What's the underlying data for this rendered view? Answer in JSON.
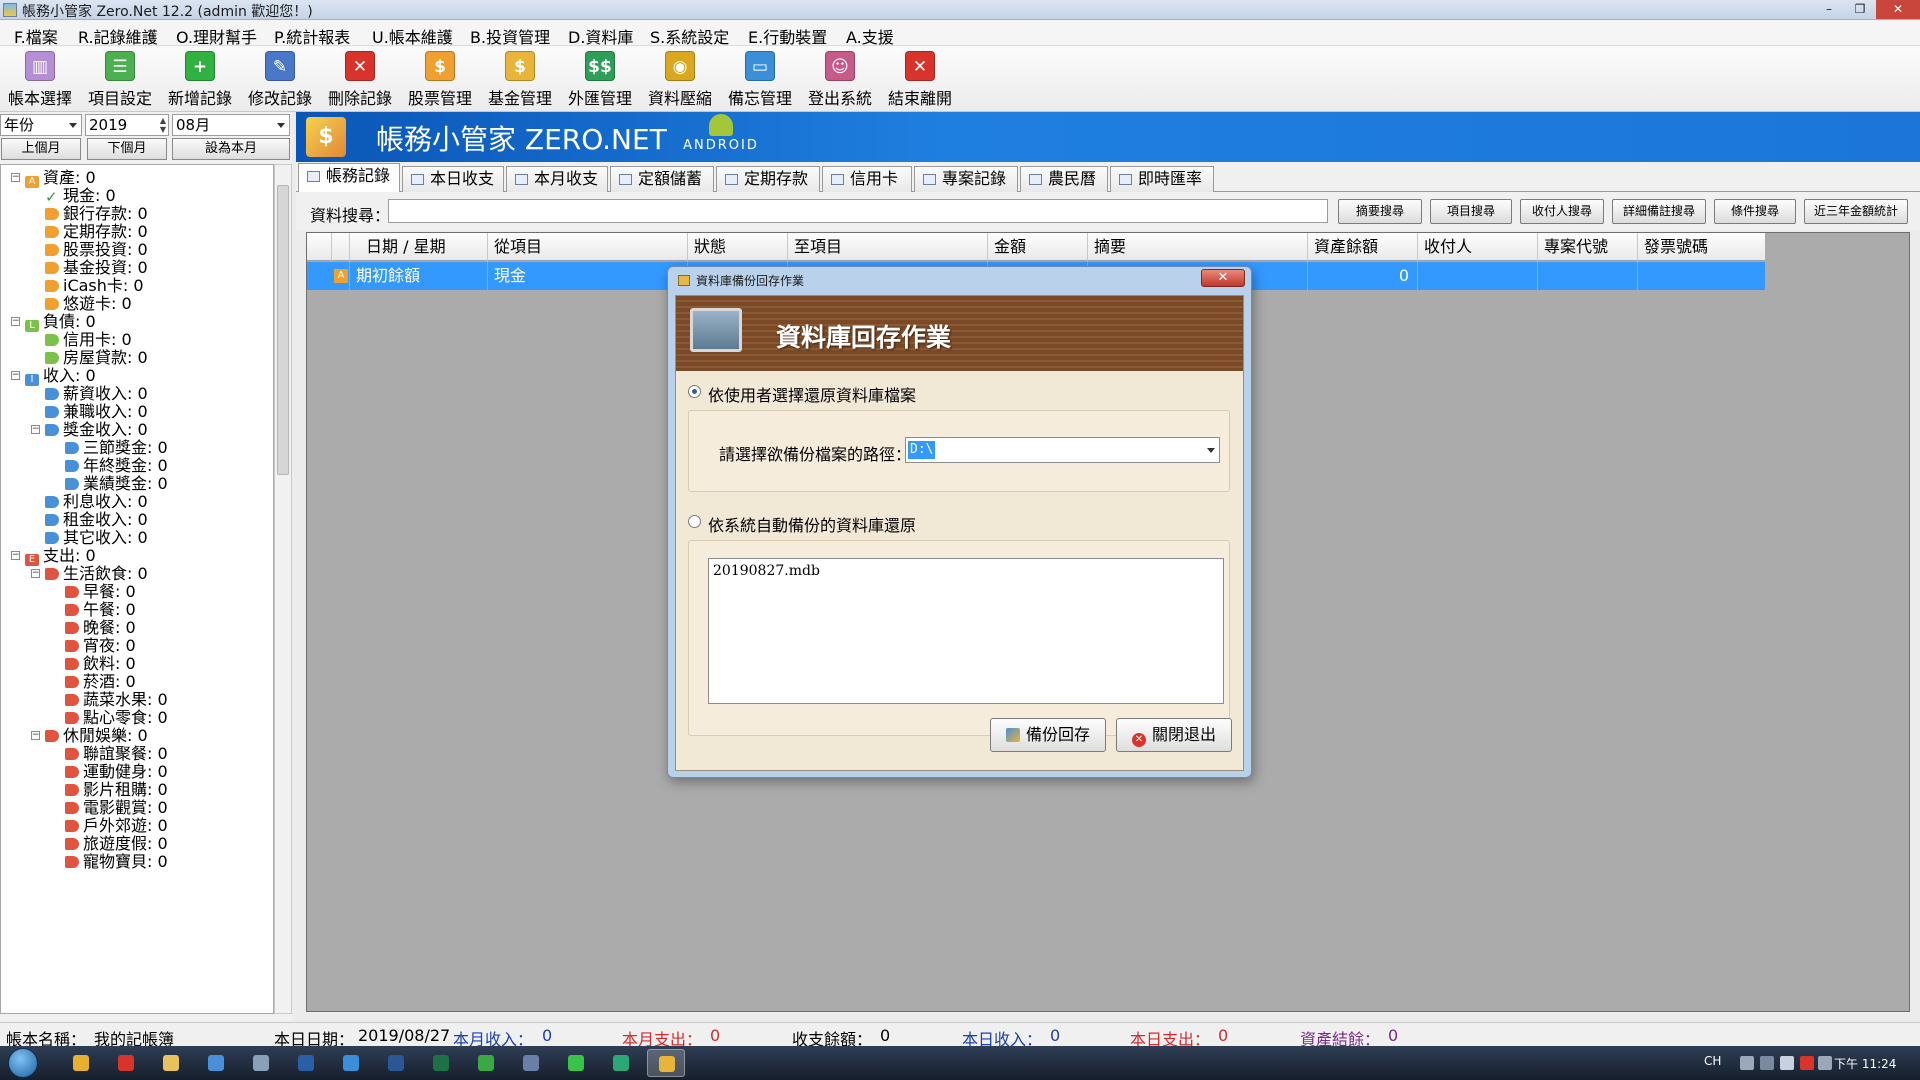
{
  "window": {
    "title": "帳務小管家 Zero.Net 12.2 (admin 歡迎您！)",
    "minimize": "–",
    "maximize": "❐",
    "close": "✕"
  },
  "menu": [
    "F.檔案",
    "R.記錄維護",
    "O.理財幫手",
    "P.統計報表",
    "U.帳本維護",
    "B.投資管理",
    "D.資料庫",
    "S.系統設定",
    "E.行動裝置",
    "A.支援"
  ],
  "toolbar": [
    {
      "label": "帳本選擇",
      "icon": "books-icon",
      "color": "#b48fd6",
      "glyph": "▥"
    },
    {
      "label": "項目設定",
      "icon": "settings-sheet-icon",
      "color": "#4caf50",
      "glyph": "☰"
    },
    {
      "label": "新增記錄",
      "icon": "add-icon",
      "color": "#31b13f",
      "glyph": "+"
    },
    {
      "label": "修改記錄",
      "icon": "edit-icon",
      "color": "#4a78c8",
      "glyph": "✎"
    },
    {
      "label": "刪除記錄",
      "icon": "delete-icon",
      "color": "#d9342b",
      "glyph": "✕"
    },
    {
      "label": "股票管理",
      "icon": "stock-icon",
      "color": "#f0a030",
      "glyph": "$"
    },
    {
      "label": "基金管理",
      "icon": "fund-icon",
      "color": "#e8b43a",
      "glyph": "$"
    },
    {
      "label": "外匯管理",
      "icon": "forex-icon",
      "color": "#2e9e58",
      "glyph": "$$"
    },
    {
      "label": "資料壓縮",
      "icon": "compress-icon",
      "color": "#d9a820",
      "glyph": "◉"
    },
    {
      "label": "備忘管理",
      "icon": "memo-monitor-icon",
      "color": "#3b8fd8",
      "glyph": "▭"
    },
    {
      "label": "登出系統",
      "icon": "logout-users-icon",
      "color": "#c85a8a",
      "glyph": "☺"
    },
    {
      "label": "結束離開",
      "icon": "exit-icon",
      "color": "#d9342b",
      "glyph": "✕"
    }
  ],
  "filter": {
    "period": "年份",
    "year": "2019",
    "month": "08月",
    "prev_month": "上個月",
    "next_month": "下個月",
    "set_month": "設為本月"
  },
  "tree": [
    {
      "label": "資產: 0",
      "level": 0,
      "expander": "−",
      "badge": "A",
      "color": "#f0a030"
    },
    {
      "label": "現金: 0",
      "level": 1,
      "icon": "check-icon",
      "color": "#2e9e3a"
    },
    {
      "label": "銀行存款: 0",
      "level": 1,
      "color": "#f0a030"
    },
    {
      "label": "定期存款: 0",
      "level": 1,
      "color": "#f0a030"
    },
    {
      "label": "股票投資: 0",
      "level": 1,
      "color": "#f0a030"
    },
    {
      "label": "基金投資: 0",
      "level": 1,
      "color": "#f0a030"
    },
    {
      "label": "iCash卡: 0",
      "level": 1,
      "color": "#f0a030"
    },
    {
      "label": "悠遊卡: 0",
      "level": 1,
      "color": "#f0a030"
    },
    {
      "label": "負債: 0",
      "level": 0,
      "expander": "−",
      "badge": "L",
      "color": "#7cc24a"
    },
    {
      "label": "信用卡: 0",
      "level": 1,
      "color": "#7cc24a"
    },
    {
      "label": "房屋貸款: 0",
      "level": 1,
      "color": "#7cc24a"
    },
    {
      "label": "收入: 0",
      "level": 0,
      "expander": "−",
      "badge": "I",
      "color": "#4a90d9"
    },
    {
      "label": "薪資收入: 0",
      "level": 1,
      "color": "#4a90d9"
    },
    {
      "label": "兼職收入: 0",
      "level": 1,
      "color": "#4a90d9"
    },
    {
      "label": "獎金收入: 0",
      "level": 1,
      "expander": "−",
      "color": "#4a90d9"
    },
    {
      "label": "三節獎金: 0",
      "level": 2,
      "color": "#4a90d9"
    },
    {
      "label": "年終獎金: 0",
      "level": 2,
      "color": "#4a90d9"
    },
    {
      "label": "業績獎金: 0",
      "level": 2,
      "color": "#4a90d9"
    },
    {
      "label": "利息收入: 0",
      "level": 1,
      "color": "#4a90d9"
    },
    {
      "label": "租金收入: 0",
      "level": 1,
      "color": "#4a90d9"
    },
    {
      "label": "其它收入: 0",
      "level": 1,
      "color": "#4a90d9"
    },
    {
      "label": "支出: 0",
      "level": 0,
      "expander": "−",
      "badge": "E",
      "color": "#e0533e"
    },
    {
      "label": "生活飲食: 0",
      "level": 1,
      "expander": "−",
      "color": "#e0533e"
    },
    {
      "label": "早餐: 0",
      "level": 2,
      "color": "#e0533e"
    },
    {
      "label": "午餐: 0",
      "level": 2,
      "color": "#e0533e"
    },
    {
      "label": "晚餐: 0",
      "level": 2,
      "color": "#e0533e"
    },
    {
      "label": "宵夜: 0",
      "level": 2,
      "color": "#e0533e"
    },
    {
      "label": "飲料: 0",
      "level": 2,
      "color": "#e0533e"
    },
    {
      "label": "菸酒: 0",
      "level": 2,
      "color": "#e0533e"
    },
    {
      "label": "蔬菜水果: 0",
      "level": 2,
      "color": "#e0533e"
    },
    {
      "label": "點心零食: 0",
      "level": 2,
      "color": "#e0533e"
    },
    {
      "label": "休閒娛樂: 0",
      "level": 1,
      "expander": "−",
      "color": "#e0533e"
    },
    {
      "label": "聯誼聚餐: 0",
      "level": 2,
      "color": "#e0533e"
    },
    {
      "label": "運動健身: 0",
      "level": 2,
      "color": "#e0533e"
    },
    {
      "label": "影片租購: 0",
      "level": 2,
      "color": "#e0533e"
    },
    {
      "label": "電影觀賞: 0",
      "level": 2,
      "color": "#e0533e"
    },
    {
      "label": "戶外郊遊: 0",
      "level": 2,
      "color": "#e0533e"
    },
    {
      "label": "旅遊度假: 0",
      "level": 2,
      "color": "#e0533e"
    },
    {
      "label": "寵物寶貝: 0",
      "level": 2,
      "color": "#e0533e"
    }
  ],
  "banner": {
    "title": "帳務小管家 ZERO.NET",
    "android": "ANDROID"
  },
  "tabs": [
    "帳務記錄",
    "本日收支",
    "本月收支",
    "定額儲蓄",
    "定期存款",
    "信用卡",
    "專案記錄",
    "農民曆",
    "即時匯率"
  ],
  "search": {
    "label": "資料搜尋：",
    "buttons": [
      "摘要搜尋",
      "項目搜尋",
      "收付人搜尋",
      "詳細備註搜尋",
      "條件搜尋",
      "近三年金額統計"
    ]
  },
  "grid": {
    "columns": [
      "日期 / 星期",
      "從項目",
      "狀態",
      "至項目",
      "金額",
      "摘要",
      "資產餘額",
      "收付人",
      "專案代號",
      "發票號碼"
    ],
    "rows": [
      {
        "badge": "A",
        "date": "期初餘額",
        "from": "現金",
        "status": "",
        "to": "",
        "amount": "",
        "memo": "",
        "balance": "0",
        "payee": "",
        "project": "",
        "invoice": ""
      }
    ]
  },
  "dialog": {
    "title": "資料庫備份回存作業",
    "close": "✕",
    "banner": "資料庫回存作業",
    "option1": "依使用者選擇還原資料庫檔案",
    "path_label": "請選擇欲備份檔案的路徑：",
    "path_value": "D:\\",
    "option2": "依系統自動備份的資料庫還原",
    "backups": [
      "20190827.mdb"
    ],
    "restore_button": "備份回存",
    "close_button": "關閉退出"
  },
  "status": {
    "ledger_label": "帳本名稱：",
    "ledger_name": "我的記帳簿",
    "date_label": "本日日期：",
    "date": "2019/08/27",
    "month_income_label": "本月收入：",
    "month_income": "0",
    "month_expense_label": "本月支出：",
    "month_expense": "0",
    "balance_label": "收支餘額：",
    "balance": "0",
    "day_income_label": "本日收入：",
    "day_income": "0",
    "day_expense_label": "本日支出：",
    "day_expense": "0",
    "asset_label": "資產結餘：",
    "asset": "0"
  },
  "taskbar": {
    "lang": "CH",
    "clock": "下午 11:24",
    "apps": [
      {
        "icon": "chrome-icon",
        "color": "#e8b030"
      },
      {
        "icon": "chrome-alt-icon",
        "color": "#d9342b"
      },
      {
        "icon": "file-explorer-icon",
        "color": "#e8c25a"
      },
      {
        "icon": "download-icon",
        "color": "#4a90d9"
      },
      {
        "icon": "network-icon",
        "color": "#8aa0b8"
      },
      {
        "icon": "photoshop-icon",
        "color": "#2a5fa8"
      },
      {
        "icon": "dropbox-icon",
        "color": "#3b8fd8"
      },
      {
        "icon": "word-icon",
        "color": "#2b5797"
      },
      {
        "icon": "excel-icon",
        "color": "#1e7145"
      },
      {
        "icon": "green-app-icon",
        "color": "#3aa845"
      },
      {
        "icon": "archive-icon",
        "color": "#6a7fa8"
      },
      {
        "icon": "line-icon",
        "color": "#3ac34a"
      },
      {
        "icon": "chart-app-icon",
        "color": "#2aa878"
      },
      {
        "icon": "ledger-app-icon",
        "color": "#e8b43a"
      }
    ]
  }
}
